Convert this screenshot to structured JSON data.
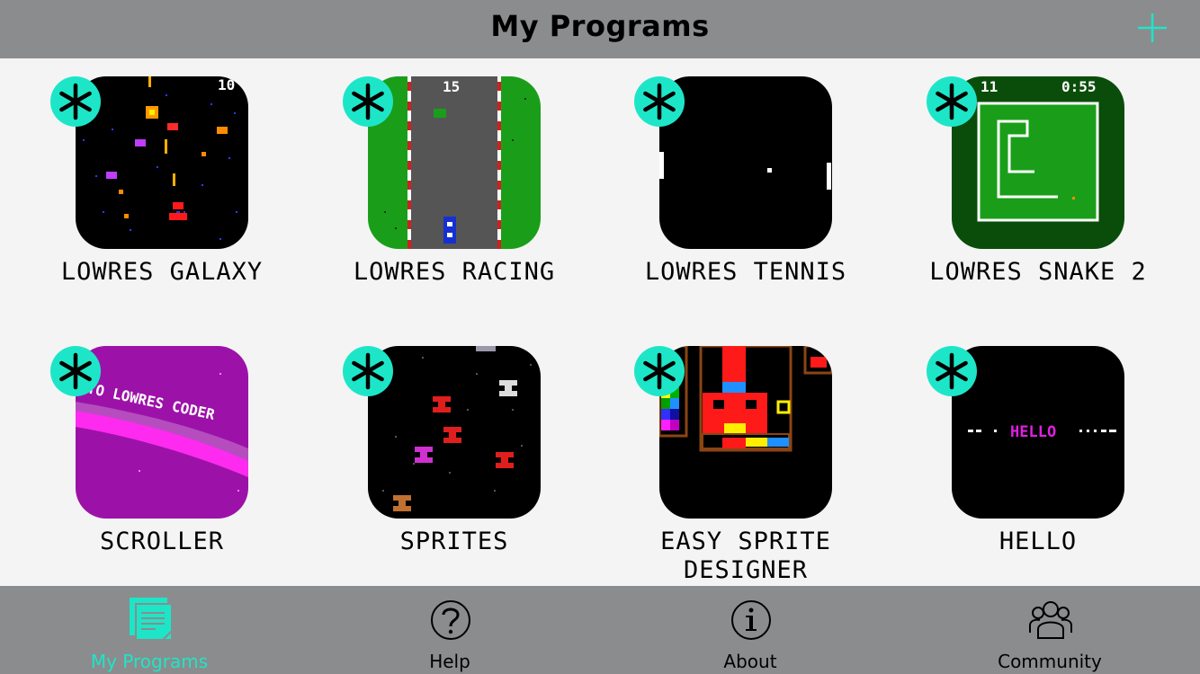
{
  "header": {
    "title": "My Programs"
  },
  "programs": [
    {
      "label": "LOWRES GALAXY",
      "score_text": "10"
    },
    {
      "label": "LOWRES RACING",
      "score_text": "15"
    },
    {
      "label": "LOWRES TENNIS"
    },
    {
      "label": "LOWRES SNAKE 2",
      "score_text": "11",
      "time_text": "0:55"
    },
    {
      "label": "SCROLLER",
      "screen_text": "TO LOWRES CODER"
    },
    {
      "label": "SPRITES"
    },
    {
      "label": "EASY SPRITE DESIGNER"
    },
    {
      "label": "HELLO",
      "screen_text": "HELLO"
    }
  ],
  "tabs": [
    {
      "label": "My Programs",
      "icon": "programs-icon",
      "active": true
    },
    {
      "label": "Help",
      "icon": "help-icon"
    },
    {
      "label": "About",
      "icon": "info-icon"
    },
    {
      "label": "Community",
      "icon": "community-icon"
    }
  ],
  "colors": {
    "accent": "#1de6c8",
    "bar": "#8b8c8d",
    "background": "#f4f4f4"
  }
}
